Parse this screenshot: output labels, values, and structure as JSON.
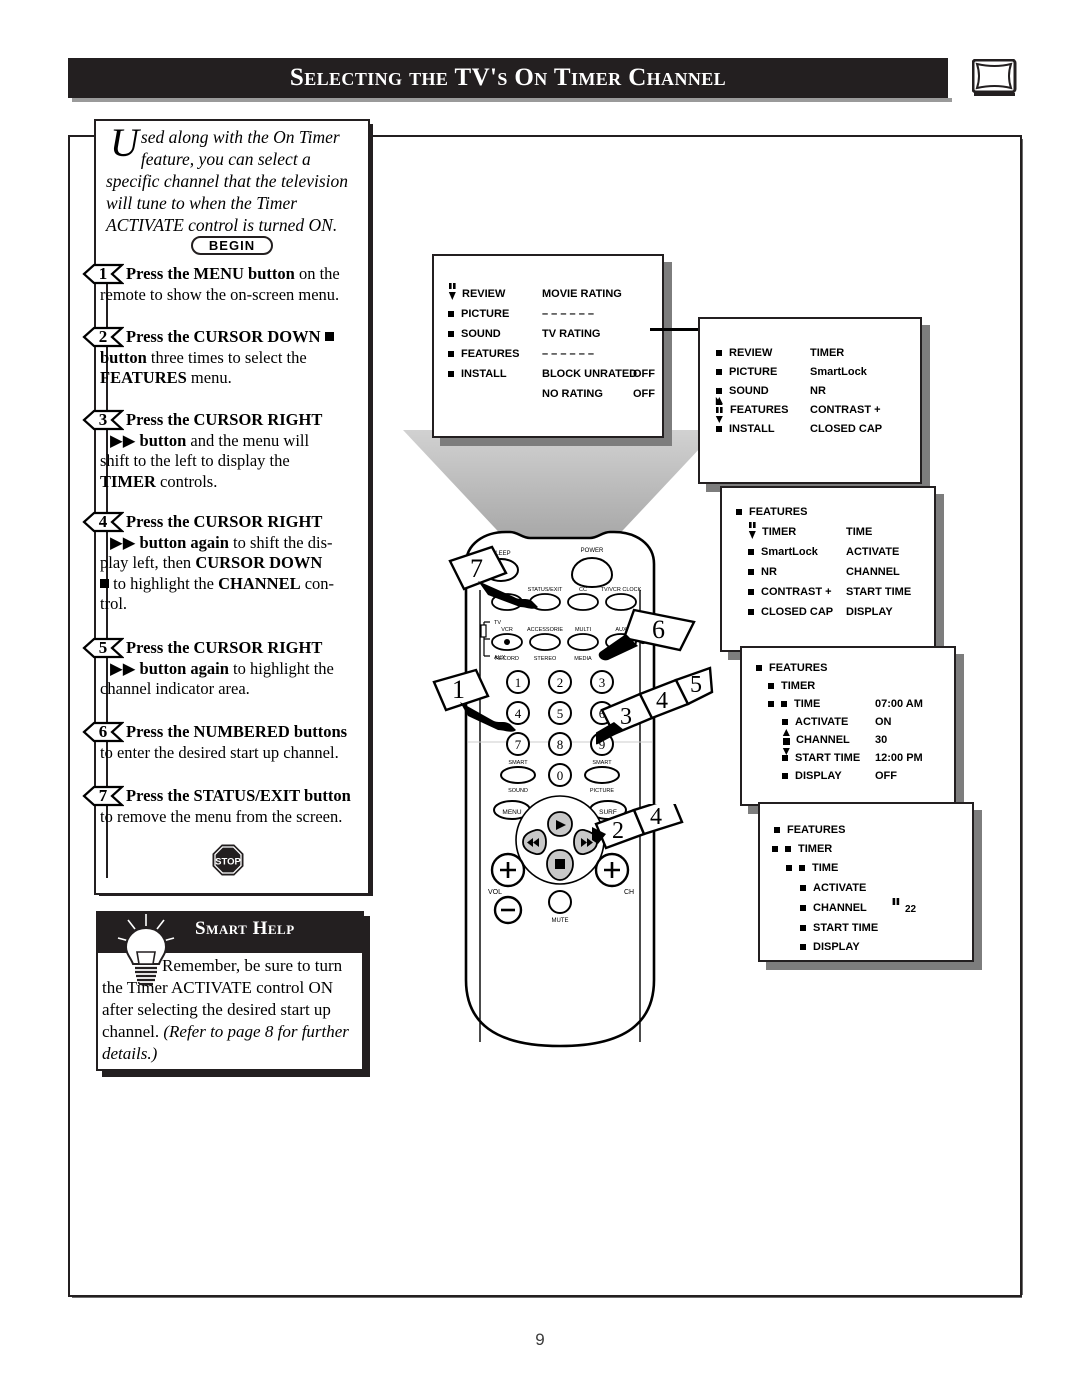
{
  "header": {
    "title": "Selecting the TV's On Timer Channel",
    "tv_icon": "tv-screen-icon"
  },
  "intro": {
    "dropcap": "U",
    "text": "sed along with the On Timer feature, you can select a specific channel that the television will tune to when the Timer ACTIVATE control is turned ON."
  },
  "begin_label": "BEGIN",
  "stop_label": "STOP",
  "steps": [
    {
      "num": "1",
      "line1_bold": "Press the MENU button",
      "line1_rest": " on the",
      "line2": "remote to show the on-screen menu."
    },
    {
      "num": "2",
      "line1_bold": "Press the CURSOR DOWN",
      "line1_rest": "",
      "line2_bold": "button",
      "line2_rest": " three times to select the",
      "line3_bold": "FEATURES",
      "line3_rest": " menu."
    },
    {
      "num": "3",
      "line1_bold": "Press the CURSOR RIGHT",
      "line2_bold": "button",
      "line2_rest": " and the menu will",
      "line3": "shift to the left to display the",
      "line4_bold": "TIMER",
      "line4_rest": " controls."
    },
    {
      "num": "4",
      "line1_bold": "Press the CURSOR RIGHT",
      "line2_bold": "button again",
      "line2_rest": " to shift the dis-",
      "line3_rest": "play left, then ",
      "line3_bold": "CURSOR DOWN",
      "line4_rest1": " to highlight the ",
      "line4_bold": "CHANNEL",
      "line4_rest2": " con-",
      "line5": "trol."
    },
    {
      "num": "5",
      "line1_bold": "Press the CURSOR RIGHT",
      "line2_bold": "button again",
      "line2_rest": " to highlight the",
      "line3": "channel indicator area."
    },
    {
      "num": "6",
      "line1_bold": "Press the NUMBERED buttons",
      "line2": "to enter the desired start up channel."
    },
    {
      "num": "7",
      "line1_bold": "Press the STATUS/EXIT button",
      "line2": "to remove the menu from the screen."
    }
  ],
  "smart_help": {
    "title": "Smart Help",
    "icon": "lightbulb-icon",
    "body_plain": "Remember, be sure to turn the Timer ACTIVATE control ON after selecting the desired start up channel. ",
    "body_italic": "(Refer to page 8 for further details.)"
  },
  "osd_menus": [
    {
      "name": "review-menu",
      "left_items": [
        "REVIEW",
        "PICTURE",
        "SOUND",
        "FEATURES",
        "INSTALL"
      ],
      "right_items": [
        {
          "label": "MOVIE RATING",
          "value": ""
        },
        {
          "label": "– – – – – –",
          "value": ""
        },
        {
          "label": "TV RATING",
          "value": ""
        },
        {
          "label": "– – – – – –",
          "value": ""
        },
        {
          "label": "BLOCK UNRATED",
          "value": "OFF"
        },
        {
          "label": "NO RATING",
          "value": "OFF"
        }
      ],
      "cursor_on": "REVIEW"
    },
    {
      "name": "features-menu",
      "left_items": [
        "REVIEW",
        "PICTURE",
        "SOUND",
        "FEATURES",
        "INSTALL"
      ],
      "right_items": [
        {
          "label": "TIMER",
          "value": ""
        },
        {
          "label": "SmartLock",
          "value": ""
        },
        {
          "label": "NR",
          "value": ""
        },
        {
          "label": "CONTRAST +",
          "value": ""
        },
        {
          "label": "CLOSED CAP",
          "value": ""
        }
      ],
      "cursor_on": "FEATURES"
    },
    {
      "name": "timer-menu",
      "header": "FEATURES",
      "left_items": [
        "TIMER",
        "SmartLock",
        "NR",
        "CONTRAST +",
        "CLOSED CAP"
      ],
      "right_items": [
        {
          "label": "TIME",
          "value": ""
        },
        {
          "label": "ACTIVATE",
          "value": ""
        },
        {
          "label": "CHANNEL",
          "value": ""
        },
        {
          "label": "START TIME",
          "value": ""
        },
        {
          "label": "DISPLAY",
          "value": ""
        }
      ],
      "cursor_on": "TIMER"
    },
    {
      "name": "timer-values-menu",
      "header": "FEATURES",
      "subheader": "TIMER",
      "rows": [
        {
          "label": "TIME",
          "value": "07:00 AM"
        },
        {
          "label": "ACTIVATE",
          "value": "ON"
        },
        {
          "label": "CHANNEL",
          "value": "30"
        },
        {
          "label": "START TIME",
          "value": "12:00 PM"
        },
        {
          "label": "DISPLAY",
          "value": "OFF"
        }
      ],
      "cursor_on": "CHANNEL"
    },
    {
      "name": "channel-entry-menu",
      "header": "FEATURES",
      "subheader": "TIMER",
      "rows": [
        {
          "label": "TIME",
          "value": ""
        },
        {
          "label": "ACTIVATE",
          "value": ""
        },
        {
          "label": "CHANNEL",
          "value": "22"
        },
        {
          "label": "START TIME",
          "value": ""
        },
        {
          "label": "DISPLAY",
          "value": ""
        }
      ],
      "cursor_on": "CHANNEL"
    }
  ],
  "remote": {
    "buttons_top": [
      "SLEEP",
      "POWER"
    ],
    "buttons_row2": [
      "STATUS/EXIT",
      "CC",
      "TV/VCR CLOCK"
    ],
    "source_labels": [
      "TV",
      "VCR",
      "AUX"
    ],
    "buttons_row3": [
      "VCR",
      "ACCESSORIE",
      "MULTI",
      "AUX"
    ],
    "buttons_row3_sub": [
      "RECORD",
      "STEREO",
      "MEDIA"
    ],
    "keypad": [
      "1",
      "2",
      "3",
      "4",
      "5",
      "6",
      "7",
      "8",
      "9",
      "0"
    ],
    "smart_sound": "SMART SOUND",
    "smart_picture": "SMART PICTURE",
    "menu": "MENU",
    "surf": "SURF",
    "vol": "VOL",
    "ch": "CH",
    "mute": "MUTE"
  },
  "callouts": [
    "1",
    "2",
    "3",
    "4",
    "5",
    "6",
    "7"
  ],
  "page_number": "9"
}
